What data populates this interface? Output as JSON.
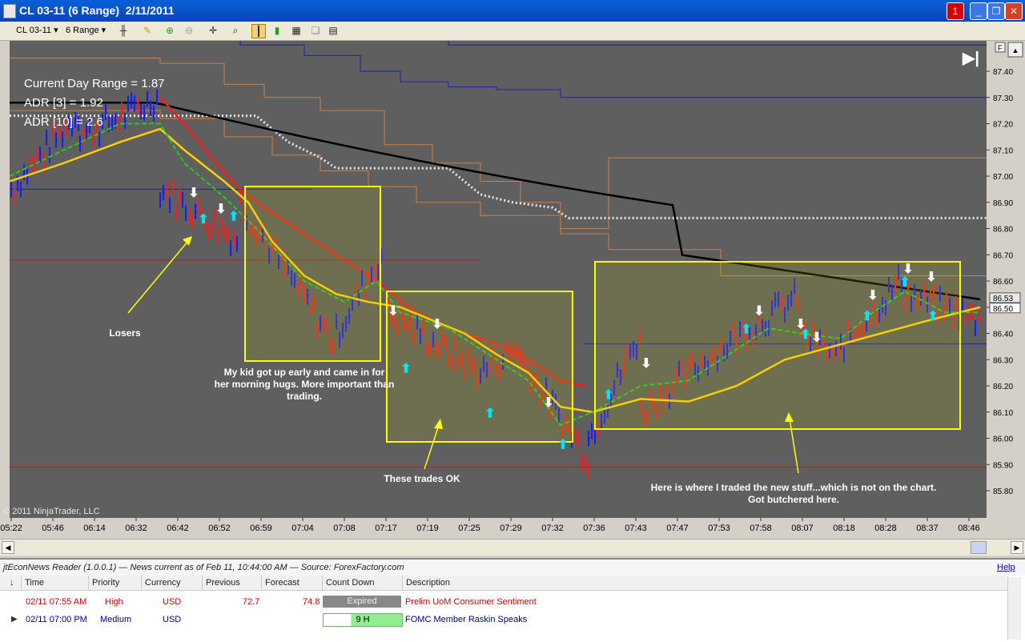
{
  "window": {
    "title": "CL 03-11 (6 Range)  2/11/2011",
    "alert_badge": "1"
  },
  "toolbar": {
    "instrument": "CL 03-11",
    "period": "6 Range",
    "icons": [
      "bar-type-icon",
      "pencil-icon",
      "zoom-in-icon",
      "zoom-out-icon",
      "crosshair-icon",
      "search-icon",
      "bar-style-icon",
      "candle-icon",
      "chart-icon",
      "copy-icon",
      "properties-icon"
    ]
  },
  "chart": {
    "f_button": "F",
    "jump_symbol": "▶|",
    "copyright": "© 2011 NinjaTrader, LLC",
    "stats": [
      "Current Day Range = 1.87",
      "ADR [3] = 1.92",
      "ADR [10] = 2.6"
    ],
    "price_labels": [
      "87.40",
      "87.30",
      "87.20",
      "87.10",
      "87.00",
      "86.90",
      "86.80",
      "86.70",
      "86.60",
      "86.50",
      "86.40",
      "86.30",
      "86.20",
      "86.10",
      "86.00",
      "85.90",
      "85.80"
    ],
    "current_price_labels": [
      "86.53",
      "86.50"
    ],
    "time_labels": [
      "05:22",
      "05:46",
      "06:14",
      "06:32",
      "06:42",
      "06:52",
      "06:59",
      "07:04",
      "07:08",
      "07:17",
      "07:19",
      "07:25",
      "07:29",
      "07:32",
      "07:36",
      "07:43",
      "07:47",
      "07:53",
      "07:58",
      "08:07",
      "08:18",
      "08:28",
      "08:37",
      "08:46"
    ],
    "annotations": {
      "losers": "Losers",
      "kid_note": [
        "My kid got up early and came in for",
        "her morning hugs. More important than",
        "trading."
      ],
      "trades_ok": "These trades OK",
      "new_stuff": [
        "Here is where I traded the new stuff...which is not on the chart.",
        "Got butchered here."
      ]
    },
    "colors": {
      "background": "#5f5f5f",
      "up_bar": "#1a1aff",
      "down_bar": "#ff1a1a",
      "ema_slow": "#000000",
      "ema_fast_red": "#ff1a1a",
      "yellow_line": "#ffd000",
      "green_line": "#22cc22",
      "box_outline": "#ffff00",
      "orange_lines": "#d08040",
      "blue_lines": "#1a1acc"
    }
  },
  "news": {
    "header": "jtEconNews Reader (1.0.0.1) — News current as of Feb 11, 10:44:00 AM — Source: ForexFactory.com",
    "help_link": "Help",
    "columns": [
      "Time",
      "Priority",
      "Currency",
      "Previous",
      "Forecast",
      "Count Down",
      "Description"
    ],
    "rows": [
      {
        "time": "02/11 07:55 AM",
        "priority": "High",
        "currency": "USD",
        "previous": "72.7",
        "forecast": "74.8",
        "countdown": "Expired",
        "description": "Prelim UoM Consumer Sentiment"
      },
      {
        "time": "02/11 07:00 PM",
        "priority": "Medium",
        "currency": "USD",
        "previous": "",
        "forecast": "",
        "countdown": "9 H",
        "description": "FOMC Member Raskin Speaks"
      }
    ]
  }
}
